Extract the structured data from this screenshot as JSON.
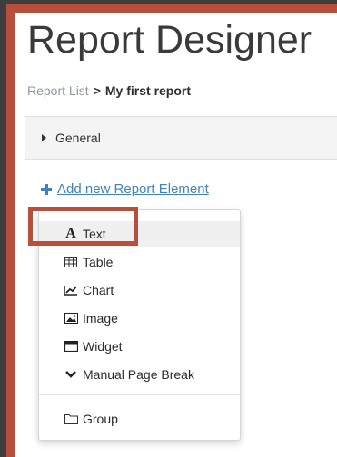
{
  "header": {
    "title": "Report Designer"
  },
  "breadcrumb": {
    "link": "Report List",
    "separator": ">",
    "current": "My first report"
  },
  "section": {
    "general_label": "General"
  },
  "add_link": {
    "label": "Add new Report Element"
  },
  "menu": {
    "items": [
      {
        "label": "Text",
        "icon": "text-icon"
      },
      {
        "label": "Table",
        "icon": "table-icon"
      },
      {
        "label": "Chart",
        "icon": "chart-icon"
      },
      {
        "label": "Image",
        "icon": "image-icon"
      },
      {
        "label": "Widget",
        "icon": "widget-icon"
      },
      {
        "label": "Manual Page Break",
        "icon": "chevron-down-icon"
      },
      {
        "label": "Group",
        "icon": "folder-icon"
      }
    ]
  },
  "colors": {
    "accent_red": "#b84f3c",
    "link_blue": "#3f82c2",
    "background": "#3d3d3d"
  }
}
